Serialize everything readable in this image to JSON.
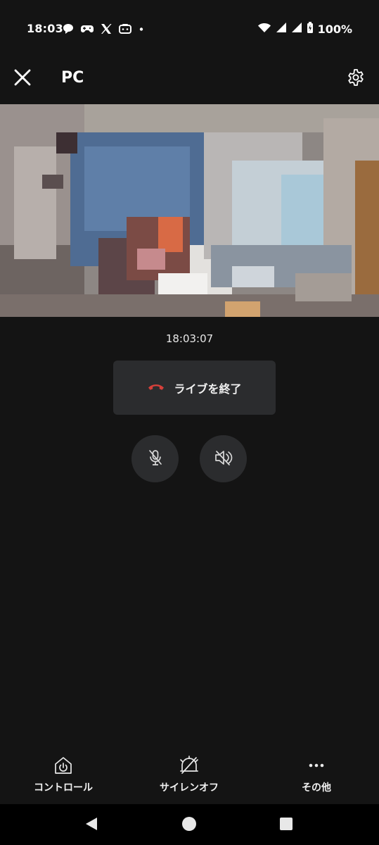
{
  "status_bar": {
    "time": "18:03",
    "notification_icons": [
      "chat-bubble-icon",
      "gamepad-icon",
      "x-logo-icon",
      "game-controller-icon",
      "dot-icon"
    ],
    "battery": "100%"
  },
  "header": {
    "title": "PC",
    "close_icon": "close-icon",
    "settings_icon": "gear-icon"
  },
  "stream": {
    "timestamp": "18:03:07",
    "end_live_label": "ライブを終了",
    "end_call_color": "#d6403a"
  },
  "controls": {
    "mic": "mic-off-icon",
    "speaker": "speaker-off-icon"
  },
  "bottom_nav": {
    "control_label": "コントロール",
    "siren_off_label": "サイレンオフ",
    "more_label": "その他"
  },
  "colors": {
    "background": "#141414",
    "button_bg": "#2b2c2e",
    "system_nav": "#000000"
  }
}
